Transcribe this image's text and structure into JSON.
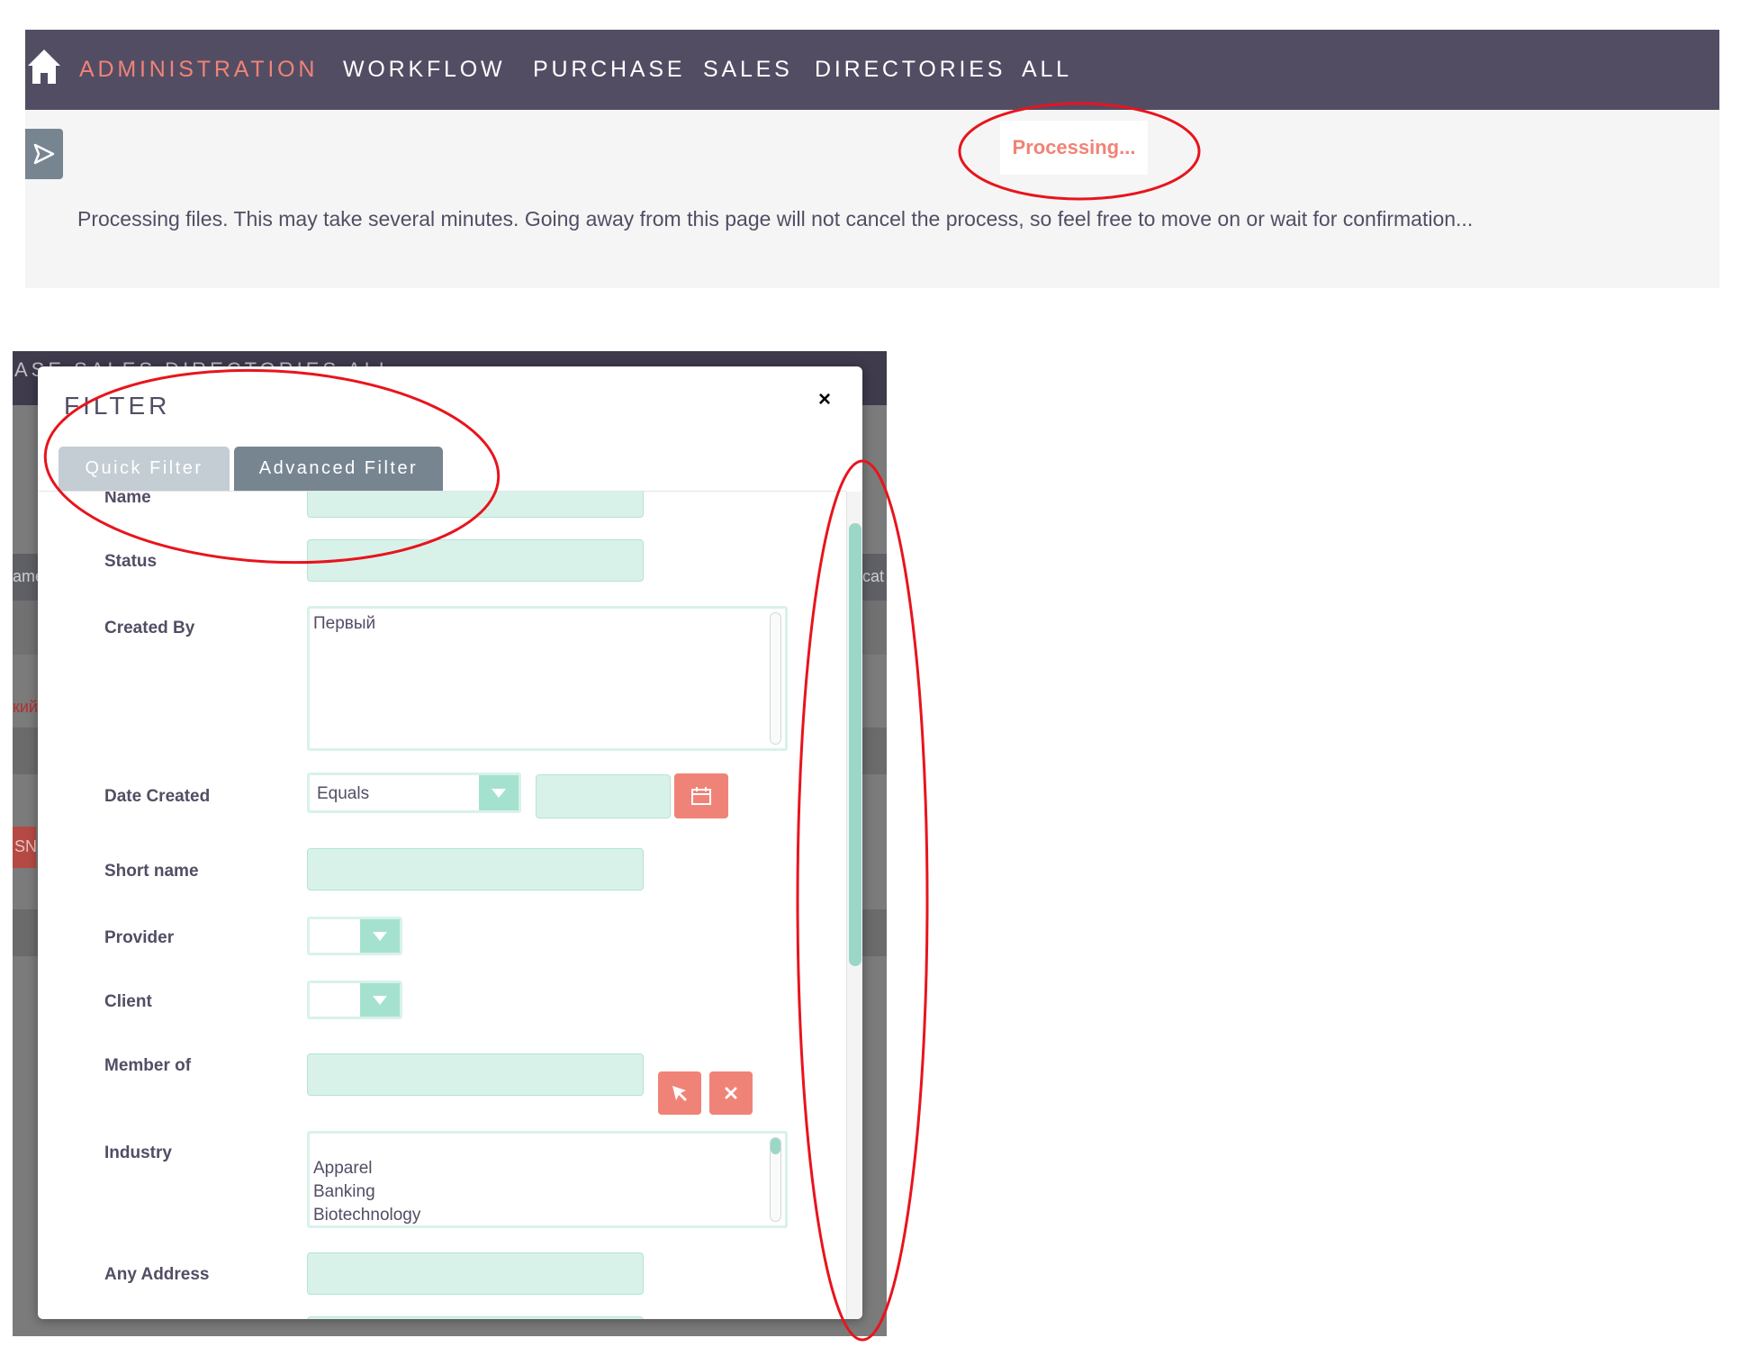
{
  "top_nav": {
    "items": [
      {
        "label": "ADMINISTRATION"
      },
      {
        "label": "WORKFLOW"
      },
      {
        "label": "PURCHASE"
      },
      {
        "label": "SALES"
      },
      {
        "label": "DIRECTORIES"
      },
      {
        "label": "ALL"
      }
    ],
    "active_item": "ADMINISTRATION"
  },
  "status": {
    "badge": "Processing...",
    "message": "Processing files. This may take several minutes. Going away from this page will not cancel the process, so feel free to move on or wait for confirmation..."
  },
  "background_page": {
    "nav_fragment": "ASE SALES DIRECTORIES ALL",
    "fragments": [
      "ame",
      "кий",
      "SN",
      "cat"
    ]
  },
  "filter_modal": {
    "title": "FILTER",
    "close_label": "×",
    "tabs": [
      {
        "label": "Quick Filter",
        "active": false
      },
      {
        "label": "Advanced Filter",
        "active": true
      }
    ],
    "fields": {
      "name": {
        "label": "Name",
        "value": ""
      },
      "status": {
        "label": "Status",
        "value": ""
      },
      "created_by": {
        "label": "Created By",
        "options": [
          "Первый"
        ]
      },
      "date_created": {
        "label": "Date Created",
        "operator": "Equals",
        "value": ""
      },
      "short_name": {
        "label": "Short name",
        "value": ""
      },
      "provider": {
        "label": "Provider",
        "value": ""
      },
      "client": {
        "label": "Client",
        "value": ""
      },
      "member_of": {
        "label": "Member of",
        "value": ""
      },
      "industry": {
        "label": "Industry",
        "options": [
          "Apparel",
          "Banking",
          "Biotechnology"
        ]
      },
      "any_address": {
        "label": "Any Address",
        "value": ""
      }
    }
  },
  "colors": {
    "nav_bg": "#534d64",
    "accent": "#f08377",
    "input_bg": "#d8f2ea",
    "tab_active": "#778591",
    "tab_inactive": "#c3cdd3",
    "annotation": "#e8141c"
  },
  "icons": [
    "home-icon",
    "send-icon",
    "close-icon",
    "calendar-icon",
    "select-arrow-icon",
    "cursor-arrow-icon",
    "clear-x-icon"
  ]
}
